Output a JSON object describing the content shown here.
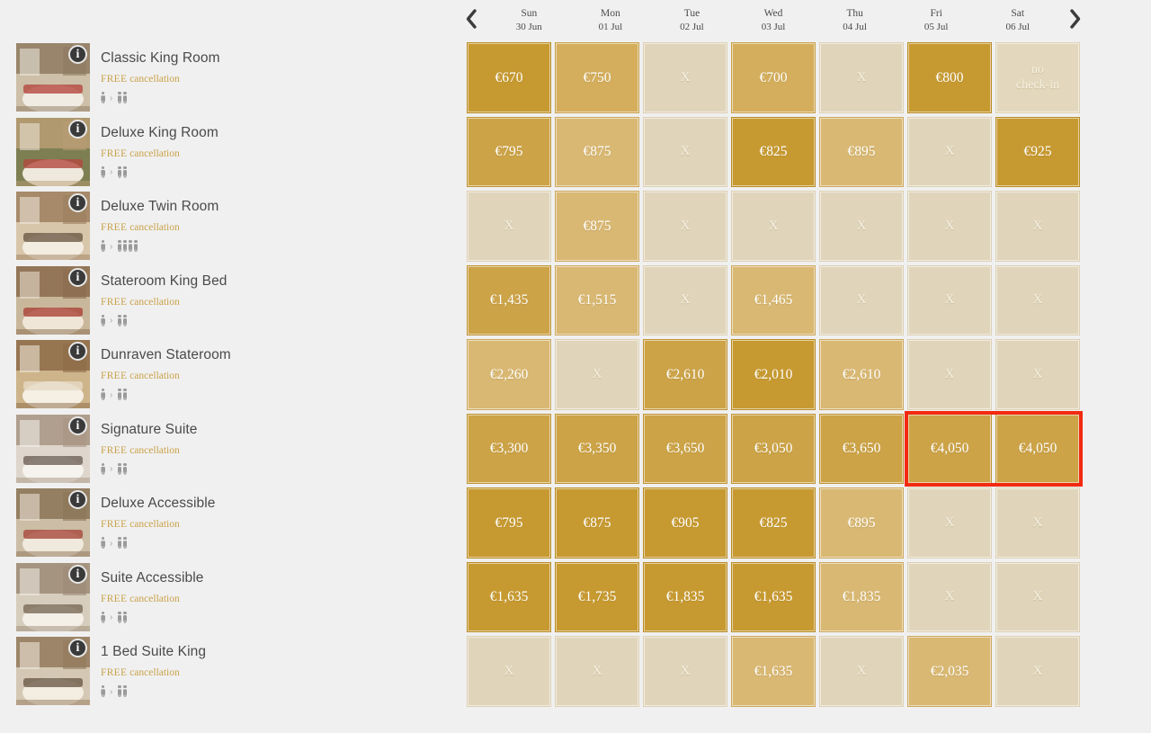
{
  "nav": {
    "prev_label": "‹",
    "prev_icon": "chevron-left-icon",
    "next_label": "›",
    "next_icon": "chevron-right-icon"
  },
  "days": [
    {
      "dow": "Sun",
      "date": "30 Jun"
    },
    {
      "dow": "Mon",
      "date": "01 Jul"
    },
    {
      "dow": "Tue",
      "date": "02 Jul"
    },
    {
      "dow": "Wed",
      "date": "03 Jul"
    },
    {
      "dow": "Thu",
      "date": "04 Jul"
    },
    {
      "dow": "Fri",
      "date": "05 Jul"
    },
    {
      "dow": "Sat",
      "date": "06 Jul"
    }
  ],
  "cancellation": {
    "free": "FREE",
    "rest": " cancellation"
  },
  "info_icon_label": "i",
  "rooms": [
    {
      "name": "Classic King Room",
      "occupancy_from": 1,
      "occupancy_to": 2,
      "thumb_palette": [
        "#cdbfa8",
        "#8e7a60",
        "#b5483f",
        "#f1ece3"
      ]
    },
    {
      "name": "Deluxe King Room",
      "occupancy_from": 1,
      "occupancy_to": 2,
      "thumb_palette": [
        "#7d7f53",
        "#b99d74",
        "#b24a3e",
        "#efe8dc"
      ]
    },
    {
      "name": "Deluxe Twin Room",
      "occupancy_from": 1,
      "occupancy_to": 4,
      "thumb_palette": [
        "#d8c6ab",
        "#9d7f5e",
        "#6e5a46",
        "#f3ece0"
      ]
    },
    {
      "name": "Stateroom King Bed",
      "occupancy_from": 1,
      "occupancy_to": 2,
      "thumb_palette": [
        "#c9b79b",
        "#8a6b4c",
        "#aa4338",
        "#efe6d8"
      ]
    },
    {
      "name": "Dunraven Stateroom",
      "occupancy_from": 1,
      "occupancy_to": 2,
      "thumb_palette": [
        "#cdb48a",
        "#8c6a46",
        "#e6dac4",
        "#f5efe4"
      ]
    },
    {
      "name": "Signature Suite",
      "occupancy_from": 1,
      "occupancy_to": 2,
      "thumb_palette": [
        "#ded6cc",
        "#a89582",
        "#6f6257",
        "#f6f3ee"
      ]
    },
    {
      "name": "Deluxe Accessible",
      "occupancy_from": 1,
      "occupancy_to": 2,
      "thumb_palette": [
        "#cbbda6",
        "#8b7456",
        "#a8483c",
        "#f0e9dd"
      ]
    },
    {
      "name": "Suite Accessible",
      "occupancy_from": 1,
      "occupancy_to": 2,
      "thumb_palette": [
        "#d6cdbd",
        "#9c8b76",
        "#7a6a58",
        "#f4efe7"
      ]
    },
    {
      "name": "1 Bed Suite King",
      "occupancy_from": 1,
      "occupancy_to": 2,
      "thumb_palette": [
        "#d4c8b4",
        "#93795c",
        "#6b5b48",
        "#f2ece1"
      ]
    }
  ],
  "unavailable_label": "X",
  "no_checkin_label": "no check-in",
  "grid": [
    [
      {
        "text": "€670",
        "level": 1
      },
      {
        "text": "€750",
        "level": 3
      },
      {
        "text": "X",
        "level": "x"
      },
      {
        "text": "€700",
        "level": 3
      },
      {
        "text": "X",
        "level": "x"
      },
      {
        "text": "€800",
        "level": 1
      },
      {
        "text": "no check-in",
        "level": "nocheckin"
      }
    ],
    [
      {
        "text": "€795",
        "level": 2
      },
      {
        "text": "€875",
        "level": 4
      },
      {
        "text": "X",
        "level": "x"
      },
      {
        "text": "€825",
        "level": 1
      },
      {
        "text": "€895",
        "level": 4
      },
      {
        "text": "X",
        "level": "x"
      },
      {
        "text": "€925",
        "level": 1
      }
    ],
    [
      {
        "text": "X",
        "level": "x"
      },
      {
        "text": "€875",
        "level": 4
      },
      {
        "text": "X",
        "level": "x"
      },
      {
        "text": "X",
        "level": "x"
      },
      {
        "text": "X",
        "level": "x"
      },
      {
        "text": "X",
        "level": "x"
      },
      {
        "text": "X",
        "level": "x"
      }
    ],
    [
      {
        "text": "€1,435",
        "level": 2
      },
      {
        "text": "€1,515",
        "level": 4
      },
      {
        "text": "X",
        "level": "x"
      },
      {
        "text": "€1,465",
        "level": 4
      },
      {
        "text": "X",
        "level": "x"
      },
      {
        "text": "X",
        "level": "x"
      },
      {
        "text": "X",
        "level": "x"
      }
    ],
    [
      {
        "text": "€2,260",
        "level": 4
      },
      {
        "text": "X",
        "level": "x"
      },
      {
        "text": "€2,610",
        "level": 2
      },
      {
        "text": "€2,010",
        "level": 1
      },
      {
        "text": "€2,610",
        "level": 4
      },
      {
        "text": "X",
        "level": "x"
      },
      {
        "text": "X",
        "level": "x"
      }
    ],
    [
      {
        "text": "€3,300",
        "level": 2
      },
      {
        "text": "€3,350",
        "level": 2
      },
      {
        "text": "€3,650",
        "level": 2
      },
      {
        "text": "€3,050",
        "level": 2
      },
      {
        "text": "€3,650",
        "level": 2
      },
      {
        "text": "€4,050",
        "level": 2,
        "selected": true
      },
      {
        "text": "€4,050",
        "level": 2,
        "selected": true
      }
    ],
    [
      {
        "text": "€795",
        "level": 1
      },
      {
        "text": "€875",
        "level": 1
      },
      {
        "text": "€905",
        "level": 1
      },
      {
        "text": "€825",
        "level": 1
      },
      {
        "text": "€895",
        "level": 4
      },
      {
        "text": "X",
        "level": "x"
      },
      {
        "text": "X",
        "level": "x"
      }
    ],
    [
      {
        "text": "€1,635",
        "level": 1
      },
      {
        "text": "€1,735",
        "level": 1
      },
      {
        "text": "€1,835",
        "level": 1
      },
      {
        "text": "€1,635",
        "level": 1
      },
      {
        "text": "€1,835",
        "level": 4
      },
      {
        "text": "X",
        "level": "x"
      },
      {
        "text": "X",
        "level": "x"
      }
    ],
    [
      {
        "text": "X",
        "level": "x"
      },
      {
        "text": "X",
        "level": "x"
      },
      {
        "text": "X",
        "level": "x"
      },
      {
        "text": "€1,635",
        "level": 4
      },
      {
        "text": "X",
        "level": "x"
      },
      {
        "text": "€2,035",
        "level": 4
      },
      {
        "text": "X",
        "level": "x"
      }
    ]
  ],
  "selection": {
    "row_index": 5,
    "col_start": 5,
    "col_end": 6
  }
}
